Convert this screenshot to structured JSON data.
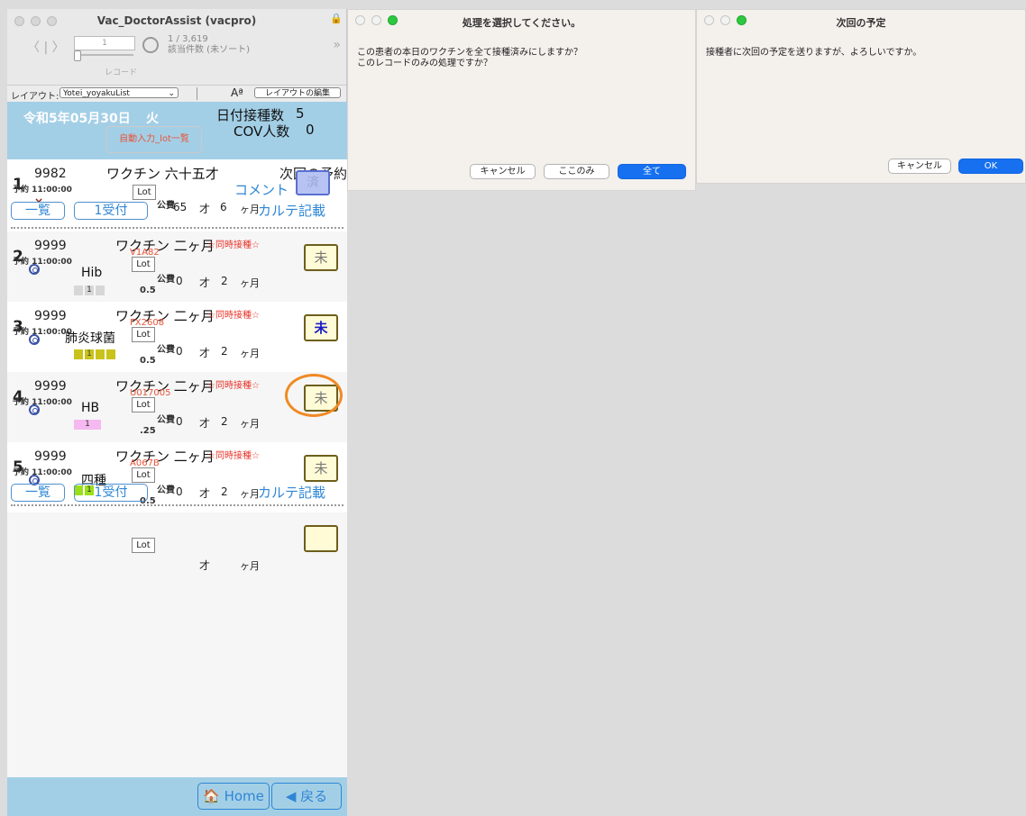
{
  "main": {
    "title": "Vac_DoctorAssist (vacpro)",
    "record_field": "1",
    "count_line1": "1 / 3,619",
    "count_line2": "該当件数 (未ソート)",
    "toolbar_label": "レコード",
    "layout_label": "レイアウト:",
    "layout_value": "Yotei_yoyakuList",
    "font_size_icon": "Aª",
    "edit_layout": "レイアウトの編集",
    "header": {
      "date": "令和5年05月30日",
      "weekday": "火",
      "count_label": "日付接種数",
      "count_value": "5",
      "cov_label": "COV人数",
      "cov_value": "0",
      "auto_lot_button": "自動入力_lot一覧"
    },
    "row1": {
      "num": "1",
      "id": "9982",
      "time": "予約 11:00:00",
      "vaccine": "ワクチン 六十五才",
      "next_label": "次回の予約",
      "comment": "コメント",
      "status": "済",
      "lot": "Lot",
      "kohi": "公費",
      "age": "65",
      "sai": "才",
      "months": "6",
      "kagetsu": "ヶ月",
      "list_btn": "一覧",
      "recv_btn": "1受付",
      "karte": "カルテ記載",
      "x": "×"
    },
    "rows": [
      {
        "num": "2",
        "id": "9999",
        "time": "予約 11:00:00",
        "vaccine": "ワクチン 二ヶ月",
        "simul": "☆同時接種☆",
        "lotcode": "V1A82",
        "lot": "Lot",
        "vname": "Hib",
        "block": "1",
        "dose": "0.5",
        "kohi": "公費",
        "age": "0",
        "sai": "才",
        "months": "2",
        "kagetsu": "ヶ月",
        "status": "未"
      },
      {
        "num": "3",
        "id": "9999",
        "time": "予約 11:00:00",
        "vaccine": "ワクチン 二ヶ月",
        "simul": "☆同時接種☆",
        "lotcode": "FX2608",
        "lot": "Lot",
        "vname": "肺炎球菌",
        "block": "1",
        "dose": "0.5",
        "kohi": "公費",
        "age": "0",
        "sai": "才",
        "months": "2",
        "kagetsu": "ヶ月",
        "status": "未"
      },
      {
        "num": "4",
        "id": "9999",
        "time": "予約 11:00:00",
        "vaccine": "ワクチン 二ヶ月",
        "simul": "☆同時接種☆",
        "lotcode": "U017005",
        "lot": "Lot",
        "vname": "HB",
        "block": "1",
        "dose": ".25",
        "kohi": "公費",
        "age": "0",
        "sai": "才",
        "months": "2",
        "kagetsu": "ヶ月",
        "status": "未"
      },
      {
        "num": "5",
        "id": "9999",
        "time": "予約 11:00:00",
        "vaccine": "ワクチン 二ヶ月",
        "simul": "☆同時接種☆",
        "lotcode": "A067B",
        "lot": "Lot",
        "vname": "四種",
        "block": "1",
        "dose": "0.5",
        "kohi": "公費",
        "age": "0",
        "sai": "才",
        "months": "2",
        "kagetsu": "ヶ月",
        "status": "未",
        "list_btn": "一覧",
        "recv_btn": "1受付",
        "karte": "カルテ記載"
      }
    ],
    "empty_row": {
      "lot": "Lot",
      "sai": "才",
      "kagetsu": "ヶ月"
    },
    "footer": {
      "home": "Home",
      "back": "戻る"
    }
  },
  "dialog1": {
    "title": "処理を選択してください。",
    "message_line1": "この患者の本日のワクチンを全て接種済みにしますか？",
    "message_line2": "このレコードのみの処理ですか？",
    "cancel": "キャンセル",
    "this_only": "ここのみ",
    "all": "全て"
  },
  "dialog2": {
    "title": "次回の予定",
    "message": "接種者に次回の予定を送りますが、よろしいですか。",
    "cancel": "キャンセル",
    "ok": "OK"
  },
  "colors": {
    "header_blue": "#a3cfe6",
    "link_blue": "#2e86d6",
    "alert_red": "#e8342a",
    "lot_orange": "#e8543a",
    "primary_button": "#1670f0",
    "highlight_ring": "#f08a24"
  }
}
